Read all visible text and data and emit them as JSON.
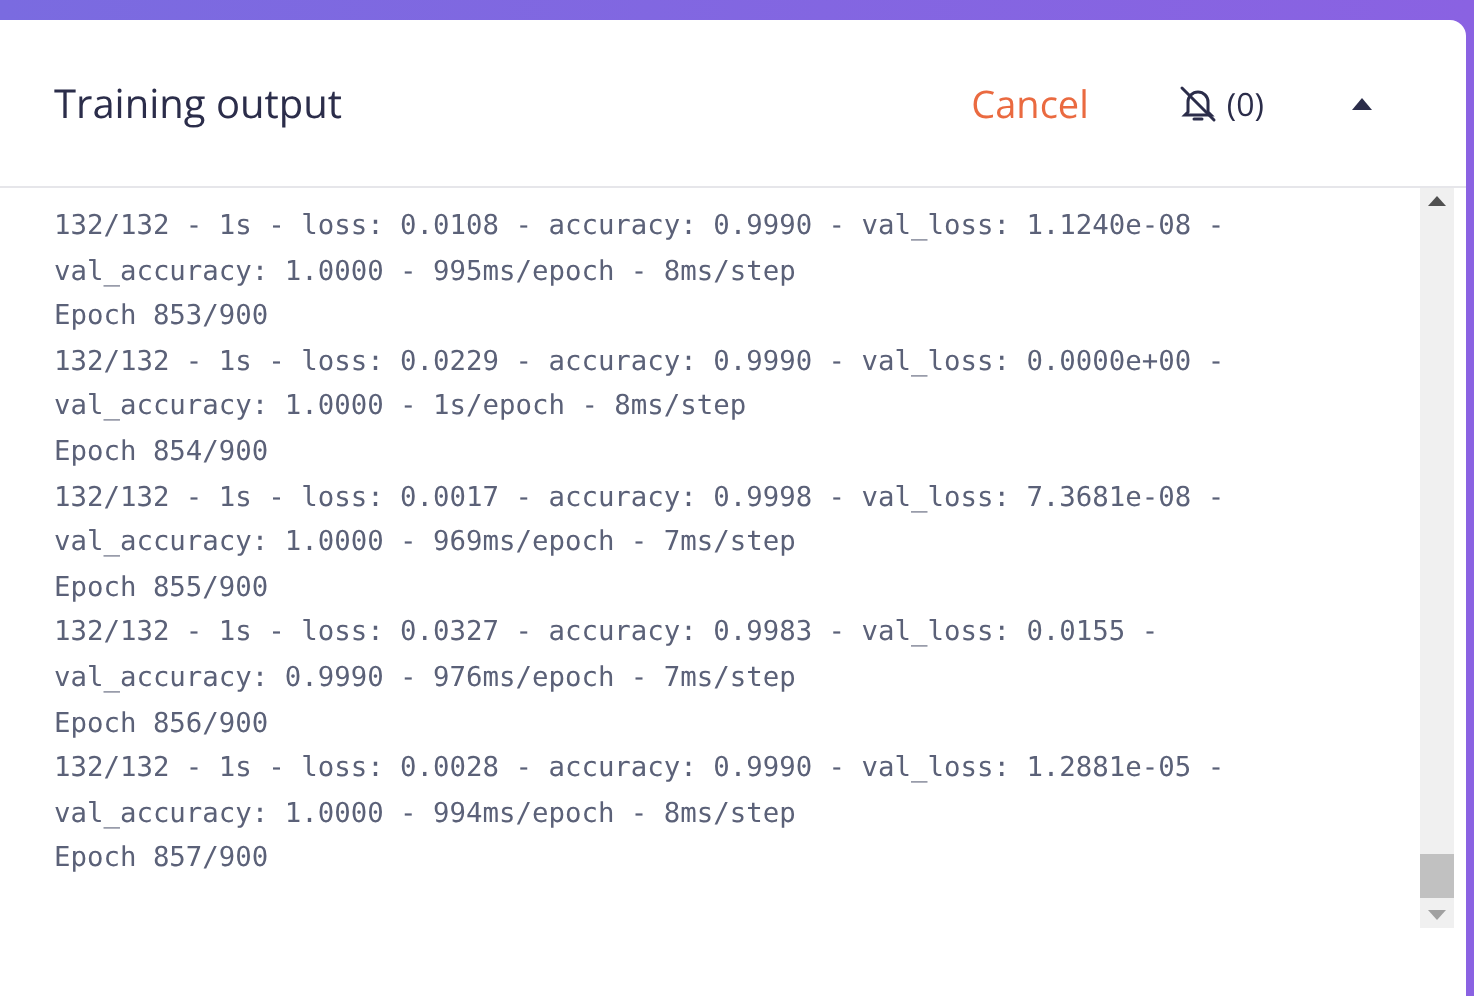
{
  "header": {
    "title": "Training output",
    "cancel": "Cancel",
    "notifications": {
      "count": "(0)",
      "muted": true
    }
  },
  "log": {
    "lines": [
      "132/132 - 1s - loss: 0.0108 - accuracy: 0.9990 - val_loss: 1.1240e-08 -",
      "val_accuracy: 1.0000 - 995ms/epoch - 8ms/step",
      "Epoch 853/900",
      "132/132 - 1s - loss: 0.0229 - accuracy: 0.9990 - val_loss: 0.0000e+00 -",
      "val_accuracy: 1.0000 - 1s/epoch - 8ms/step",
      "Epoch 854/900",
      "132/132 - 1s - loss: 0.0017 - accuracy: 0.9998 - val_loss: 7.3681e-08 -",
      "val_accuracy: 1.0000 - 969ms/epoch - 7ms/step",
      "Epoch 855/900",
      "132/132 - 1s - loss: 0.0327 - accuracy: 0.9983 - val_loss: 0.0155 -",
      "val_accuracy: 0.9990 - 976ms/epoch - 7ms/step",
      "Epoch 856/900",
      "132/132 - 1s - loss: 0.0028 - accuracy: 0.9990 - val_loss: 1.2881e-05 -",
      "val_accuracy: 1.0000 - 994ms/epoch - 8ms/step",
      "Epoch 857/900"
    ]
  }
}
